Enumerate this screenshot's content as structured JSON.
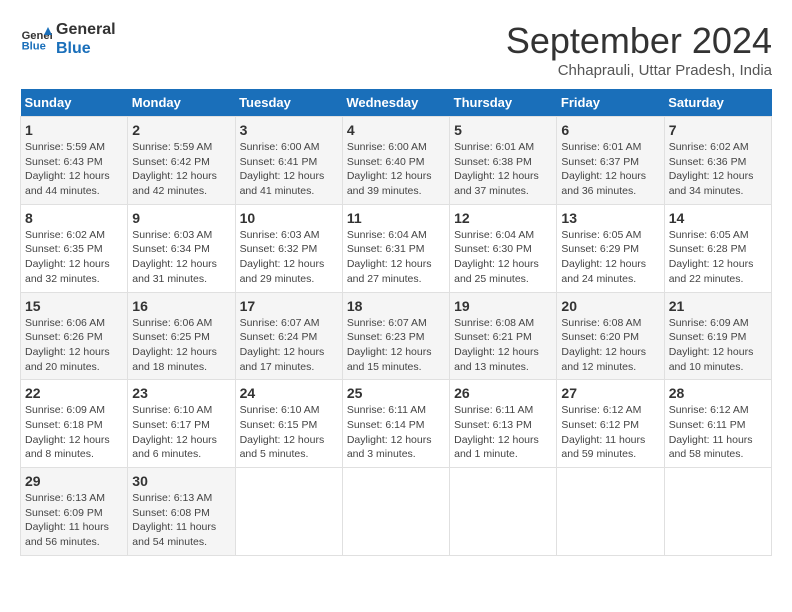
{
  "logo": {
    "line1": "General",
    "line2": "Blue"
  },
  "title": "September 2024",
  "subtitle": "Chhaprauli, Uttar Pradesh, India",
  "weekdays": [
    "Sunday",
    "Monday",
    "Tuesday",
    "Wednesday",
    "Thursday",
    "Friday",
    "Saturday"
  ],
  "weeks": [
    [
      {
        "day": "1",
        "sunrise": "Sunrise: 5:59 AM",
        "sunset": "Sunset: 6:43 PM",
        "daylight": "Daylight: 12 hours and 44 minutes."
      },
      {
        "day": "2",
        "sunrise": "Sunrise: 5:59 AM",
        "sunset": "Sunset: 6:42 PM",
        "daylight": "Daylight: 12 hours and 42 minutes."
      },
      {
        "day": "3",
        "sunrise": "Sunrise: 6:00 AM",
        "sunset": "Sunset: 6:41 PM",
        "daylight": "Daylight: 12 hours and 41 minutes."
      },
      {
        "day": "4",
        "sunrise": "Sunrise: 6:00 AM",
        "sunset": "Sunset: 6:40 PM",
        "daylight": "Daylight: 12 hours and 39 minutes."
      },
      {
        "day": "5",
        "sunrise": "Sunrise: 6:01 AM",
        "sunset": "Sunset: 6:38 PM",
        "daylight": "Daylight: 12 hours and 37 minutes."
      },
      {
        "day": "6",
        "sunrise": "Sunrise: 6:01 AM",
        "sunset": "Sunset: 6:37 PM",
        "daylight": "Daylight: 12 hours and 36 minutes."
      },
      {
        "day": "7",
        "sunrise": "Sunrise: 6:02 AM",
        "sunset": "Sunset: 6:36 PM",
        "daylight": "Daylight: 12 hours and 34 minutes."
      }
    ],
    [
      {
        "day": "8",
        "sunrise": "Sunrise: 6:02 AM",
        "sunset": "Sunset: 6:35 PM",
        "daylight": "Daylight: 12 hours and 32 minutes."
      },
      {
        "day": "9",
        "sunrise": "Sunrise: 6:03 AM",
        "sunset": "Sunset: 6:34 PM",
        "daylight": "Daylight: 12 hours and 31 minutes."
      },
      {
        "day": "10",
        "sunrise": "Sunrise: 6:03 AM",
        "sunset": "Sunset: 6:32 PM",
        "daylight": "Daylight: 12 hours and 29 minutes."
      },
      {
        "day": "11",
        "sunrise": "Sunrise: 6:04 AM",
        "sunset": "Sunset: 6:31 PM",
        "daylight": "Daylight: 12 hours and 27 minutes."
      },
      {
        "day": "12",
        "sunrise": "Sunrise: 6:04 AM",
        "sunset": "Sunset: 6:30 PM",
        "daylight": "Daylight: 12 hours and 25 minutes."
      },
      {
        "day": "13",
        "sunrise": "Sunrise: 6:05 AM",
        "sunset": "Sunset: 6:29 PM",
        "daylight": "Daylight: 12 hours and 24 minutes."
      },
      {
        "day": "14",
        "sunrise": "Sunrise: 6:05 AM",
        "sunset": "Sunset: 6:28 PM",
        "daylight": "Daylight: 12 hours and 22 minutes."
      }
    ],
    [
      {
        "day": "15",
        "sunrise": "Sunrise: 6:06 AM",
        "sunset": "Sunset: 6:26 PM",
        "daylight": "Daylight: 12 hours and 20 minutes."
      },
      {
        "day": "16",
        "sunrise": "Sunrise: 6:06 AM",
        "sunset": "Sunset: 6:25 PM",
        "daylight": "Daylight: 12 hours and 18 minutes."
      },
      {
        "day": "17",
        "sunrise": "Sunrise: 6:07 AM",
        "sunset": "Sunset: 6:24 PM",
        "daylight": "Daylight: 12 hours and 17 minutes."
      },
      {
        "day": "18",
        "sunrise": "Sunrise: 6:07 AM",
        "sunset": "Sunset: 6:23 PM",
        "daylight": "Daylight: 12 hours and 15 minutes."
      },
      {
        "day": "19",
        "sunrise": "Sunrise: 6:08 AM",
        "sunset": "Sunset: 6:21 PM",
        "daylight": "Daylight: 12 hours and 13 minutes."
      },
      {
        "day": "20",
        "sunrise": "Sunrise: 6:08 AM",
        "sunset": "Sunset: 6:20 PM",
        "daylight": "Daylight: 12 hours and 12 minutes."
      },
      {
        "day": "21",
        "sunrise": "Sunrise: 6:09 AM",
        "sunset": "Sunset: 6:19 PM",
        "daylight": "Daylight: 12 hours and 10 minutes."
      }
    ],
    [
      {
        "day": "22",
        "sunrise": "Sunrise: 6:09 AM",
        "sunset": "Sunset: 6:18 PM",
        "daylight": "Daylight: 12 hours and 8 minutes."
      },
      {
        "day": "23",
        "sunrise": "Sunrise: 6:10 AM",
        "sunset": "Sunset: 6:17 PM",
        "daylight": "Daylight: 12 hours and 6 minutes."
      },
      {
        "day": "24",
        "sunrise": "Sunrise: 6:10 AM",
        "sunset": "Sunset: 6:15 PM",
        "daylight": "Daylight: 12 hours and 5 minutes."
      },
      {
        "day": "25",
        "sunrise": "Sunrise: 6:11 AM",
        "sunset": "Sunset: 6:14 PM",
        "daylight": "Daylight: 12 hours and 3 minutes."
      },
      {
        "day": "26",
        "sunrise": "Sunrise: 6:11 AM",
        "sunset": "Sunset: 6:13 PM",
        "daylight": "Daylight: 12 hours and 1 minute."
      },
      {
        "day": "27",
        "sunrise": "Sunrise: 6:12 AM",
        "sunset": "Sunset: 6:12 PM",
        "daylight": "Daylight: 11 hours and 59 minutes."
      },
      {
        "day": "28",
        "sunrise": "Sunrise: 6:12 AM",
        "sunset": "Sunset: 6:11 PM",
        "daylight": "Daylight: 11 hours and 58 minutes."
      }
    ],
    [
      {
        "day": "29",
        "sunrise": "Sunrise: 6:13 AM",
        "sunset": "Sunset: 6:09 PM",
        "daylight": "Daylight: 11 hours and 56 minutes."
      },
      {
        "day": "30",
        "sunrise": "Sunrise: 6:13 AM",
        "sunset": "Sunset: 6:08 PM",
        "daylight": "Daylight: 11 hours and 54 minutes."
      },
      null,
      null,
      null,
      null,
      null
    ]
  ]
}
